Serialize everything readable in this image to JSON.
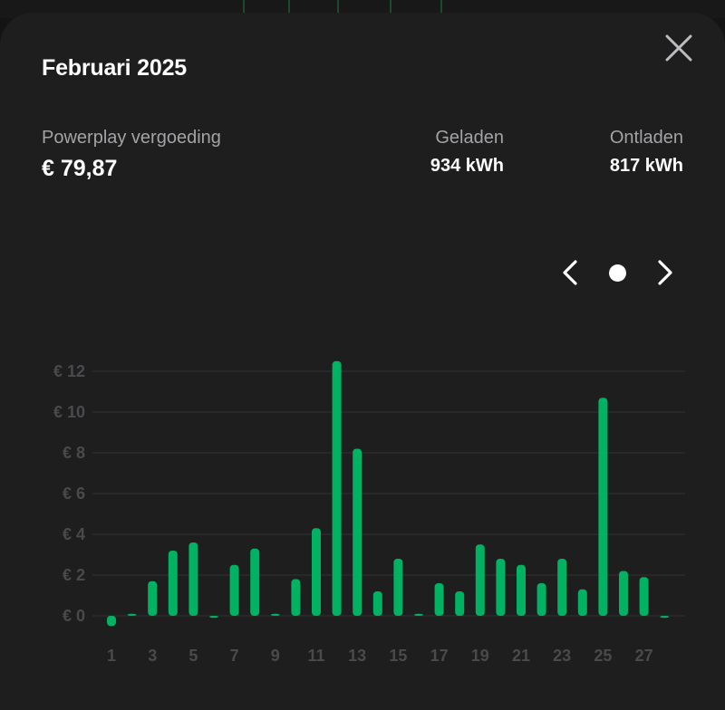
{
  "header": {
    "title": "Februari 2025"
  },
  "summary": {
    "powerplay_label": "Powerplay vergoeding",
    "powerplay_value": "€ 79,87",
    "geladen_label": "Geladen",
    "geladen_value": "934 kWh",
    "ontladen_label": "Ontladen",
    "ontladen_value": "817 kWh"
  },
  "icons": {
    "close": "close-icon",
    "prev": "chevron-left-icon",
    "next": "chevron-right-icon"
  },
  "colors": {
    "accent": "#00b262",
    "background": "#1e1e1f",
    "muted_text": "#a3a3a6",
    "axis_text": "#4a4a4d"
  },
  "chart_data": {
    "type": "bar",
    "title": "",
    "xlabel": "",
    "ylabel": "",
    "ylim": [
      0,
      12
    ],
    "grid": true,
    "y_ticks": [
      "€ 0",
      "€ 2",
      "€ 4",
      "€ 6",
      "€ 8",
      "€ 10",
      "€ 12"
    ],
    "x_tick_labels": [
      "1",
      "3",
      "5",
      "7",
      "9",
      "11",
      "13",
      "15",
      "17",
      "19",
      "21",
      "23",
      "25",
      "27"
    ],
    "categories": [
      "1",
      "2",
      "3",
      "4",
      "5",
      "6",
      "7",
      "8",
      "9",
      "10",
      "11",
      "12",
      "13",
      "14",
      "15",
      "16",
      "17",
      "18",
      "19",
      "20",
      "21",
      "22",
      "23",
      "24",
      "25",
      "26",
      "27",
      "28"
    ],
    "values": [
      -0.5,
      0.1,
      1.7,
      3.2,
      3.6,
      -0.1,
      2.5,
      3.3,
      0.1,
      1.8,
      4.3,
      12.5,
      8.2,
      1.2,
      2.8,
      0.1,
      1.6,
      1.2,
      3.5,
      2.8,
      2.5,
      1.6,
      2.8,
      1.3,
      10.7,
      2.2,
      1.9,
      -0.1
    ]
  }
}
